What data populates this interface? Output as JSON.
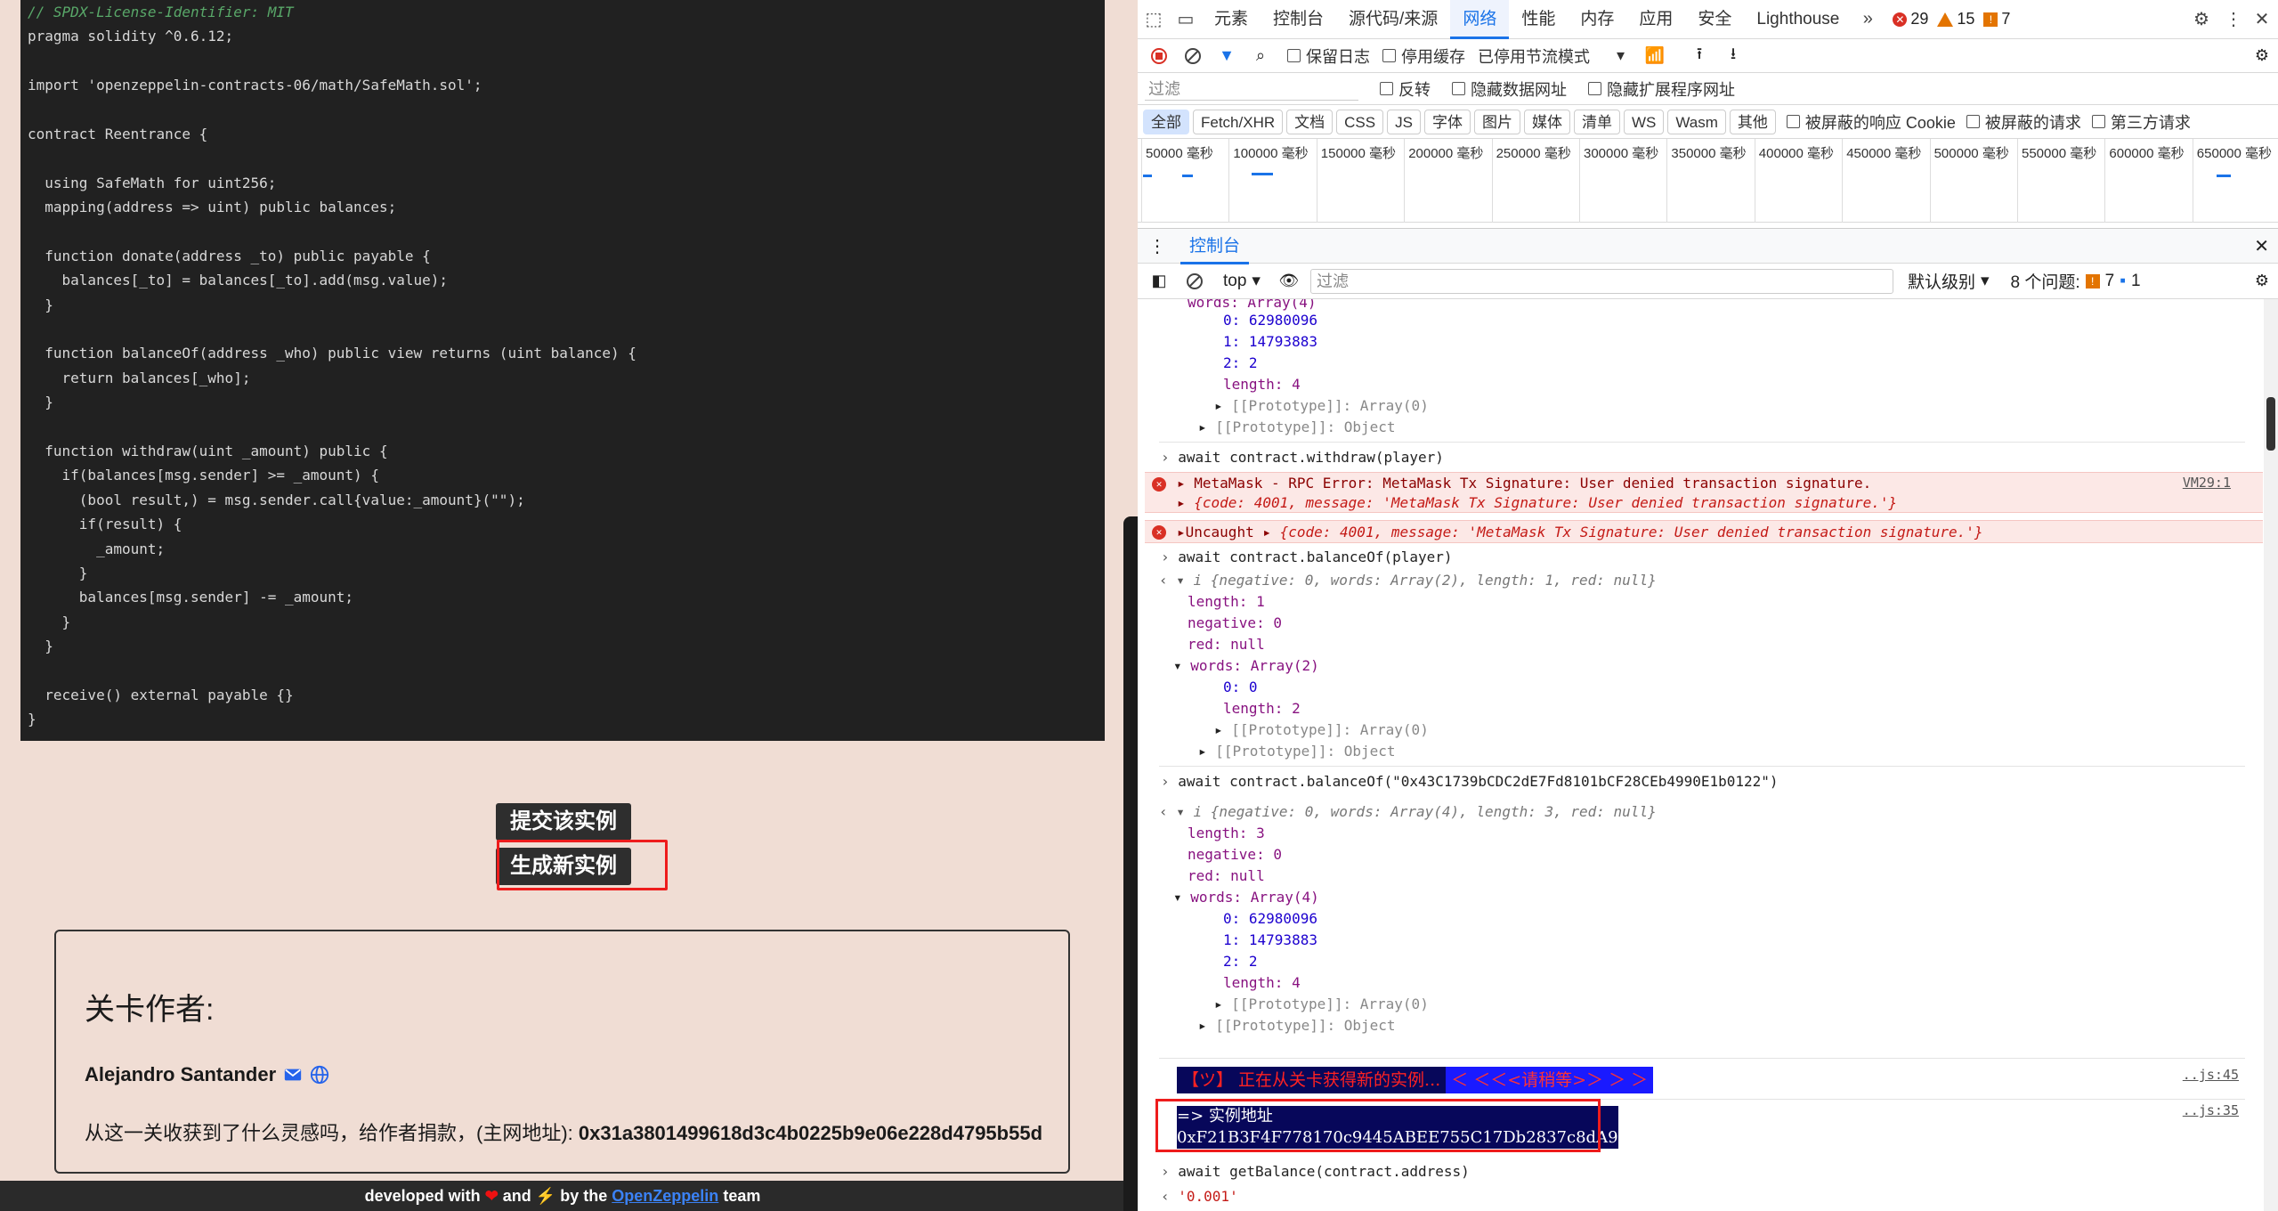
{
  "code_lines": [
    "// SPDX-License-Identifier: MIT",
    "pragma solidity ^0.6.12;",
    "",
    "import 'openzeppelin-contracts-06/math/SafeMath.sol';",
    "",
    "contract Reentrance {",
    "",
    "  using SafeMath for uint256;",
    "  mapping(address => uint) public balances;",
    "",
    "  function donate(address _to) public payable {",
    "    balances[_to] = balances[_to].add(msg.value);",
    "  }",
    "",
    "  function balanceOf(address _who) public view returns (uint balance) {",
    "    return balances[_who];",
    "  }",
    "",
    "  function withdraw(uint _amount) public {",
    "    if(balances[msg.sender] >= _amount) {",
    "      (bool result,) = msg.sender.call{value:_amount}(\"\");",
    "      if(result) {",
    "        _amount;",
    "      }",
    "      balances[msg.sender] -= _amount;",
    "    }",
    "  }",
    "",
    "  receive() external payable {}",
    "}"
  ],
  "buttons": {
    "submit": "提交该实例",
    "new_instance": "生成新实例"
  },
  "author": {
    "title": "关卡作者:",
    "name": "Alejandro Santander",
    "donate_text": "从这一关收获到了什么灵感吗，给作者捐款，(主网地址):",
    "donate_addr": "0x31a3801499618d3c4b0225b9e06e228d4795b55d"
  },
  "footer": {
    "pre": "developed with",
    "mid": "and",
    "mid2": "by the",
    "link": "OpenZeppelin",
    "post": "team"
  },
  "devtools": {
    "tabs": [
      "元素",
      "控制台",
      "源代码/来源",
      "网络",
      "性能",
      "内存",
      "应用",
      "安全",
      "Lighthouse"
    ],
    "active_tab": "网络",
    "errors": "29",
    "warnings": "15",
    "issues": "7",
    "toolbar": {
      "preserve_log": "保留日志",
      "disable_cache": "停用缓存",
      "throttle": "已停用节流模式"
    },
    "filter": {
      "placeholder": "过滤",
      "invert": "反转",
      "hide_data": "隐藏数据网址",
      "hide_ext": "隐藏扩展程序网址"
    },
    "types": [
      "全部",
      "Fetch/XHR",
      "文档",
      "CSS",
      "JS",
      "字体",
      "图片",
      "媒体",
      "清单",
      "WS",
      "Wasm",
      "其他"
    ],
    "type_checks": [
      "被屏蔽的响应 Cookie",
      "被屏蔽的请求",
      "第三方请求"
    ],
    "timeline": [
      "50000 毫秒",
      "100000 毫秒",
      "150000 毫秒",
      "200000 毫秒",
      "250000 毫秒",
      "300000 毫秒",
      "350000 毫秒",
      "400000 毫秒",
      "450000 毫秒",
      "500000 毫秒",
      "550000 毫秒",
      "600000 毫秒",
      "650000 毫秒"
    ],
    "console_tab": "控制台",
    "context": "top",
    "console_filter": "过滤",
    "level": "默认级别",
    "issues_label": "8 个问题:",
    "issues_w": "7",
    "issues_i": "1"
  },
  "console": {
    "l1": "words: Array(4)",
    "w0": "0: 62980096",
    "w1": "1: 14793883",
    "w2": "2: 2",
    "wlen": "length: 4",
    "proto_arr": "[[Prototype]]: Array(0)",
    "proto_obj": "[[Prototype]]: Object",
    "cmd1": "await contract.withdraw(player)",
    "err1": "MetaMask - RPC Error: MetaMask Tx Signature: User denied transaction signature.",
    "err1_link": "VM29:1",
    "err1b": "{code: 4001, message: 'MetaMask Tx Signature: User denied transaction signature.'}",
    "err2a": "Uncaught",
    "err2b": "{code: 4001, message: 'MetaMask Tx Signature: User denied transaction signature.'}",
    "cmd2": "await contract.balanceOf(player)",
    "bn1": "{negative: 0, words: Array(2), length: 1, red: null}",
    "len1": "length: 1",
    "neg": "negative: 0",
    "red": "red: null",
    "words2": "words: Array(2)",
    "a0": "0: 0",
    "alen2": "length: 2",
    "cmd3": "await contract.balanceOf(\"0x43C1739bCDC2dE7Fd8101bCF28CEb4990E1b0122\")",
    "bn2": "{negative: 0, words: Array(4), length: 3, red: null}",
    "len3": "length: 3",
    "banner1": "【ツ】 正在从关卡获得新的实例...",
    "banner2": "＜ ＜＜<请稍等>＞ ＞ ＞",
    "link45": "..js:45",
    "addr_label": "=> 实例地址",
    "addr": "0xF21B3F4F778170c9445ABEE755C17Db2837c8dA9",
    "link35": "..js:35",
    "cmd4": "await getBalance(contract.address)",
    "res4": "'0.001'"
  }
}
